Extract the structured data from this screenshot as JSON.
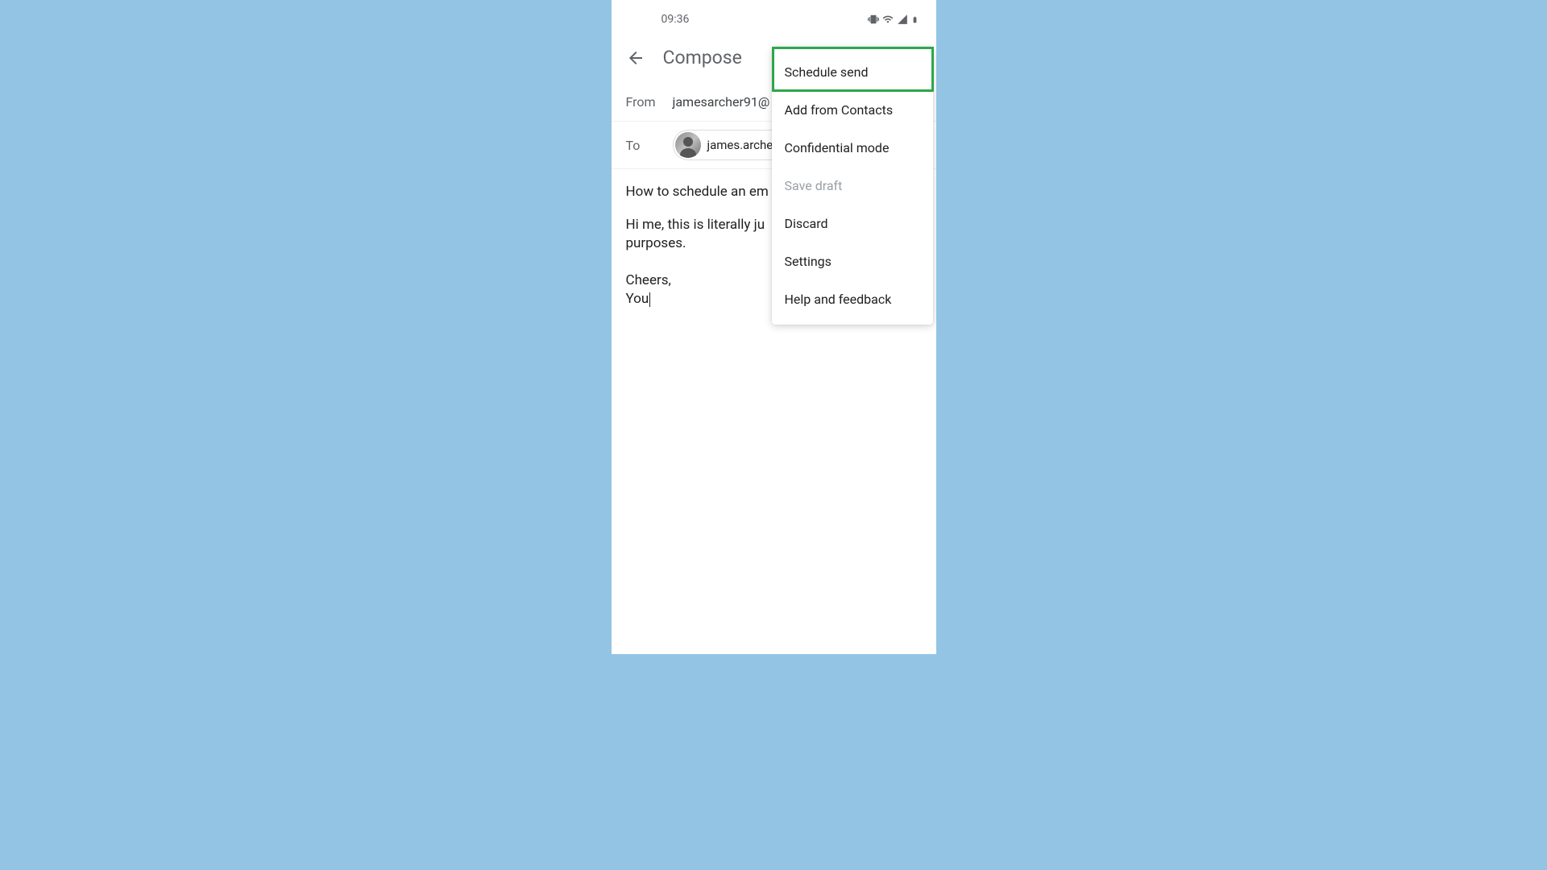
{
  "status": {
    "time": "09:36"
  },
  "header": {
    "title": "Compose"
  },
  "from": {
    "label": "From",
    "value": "jamesarcher91@"
  },
  "to": {
    "label": "To",
    "contact": "james.archer@fu"
  },
  "subject": "How to schedule an em",
  "body": {
    "line1": "Hi me, this is literally ju",
    "line2": "purposes.",
    "line3": "Cheers,",
    "line4": "You"
  },
  "menu": {
    "schedule_send": "Schedule send",
    "add_contacts": "Add from Contacts",
    "confidential": "Confidential mode",
    "save_draft": "Save draft",
    "discard": "Discard",
    "settings": "Settings",
    "help": "Help and feedback"
  }
}
